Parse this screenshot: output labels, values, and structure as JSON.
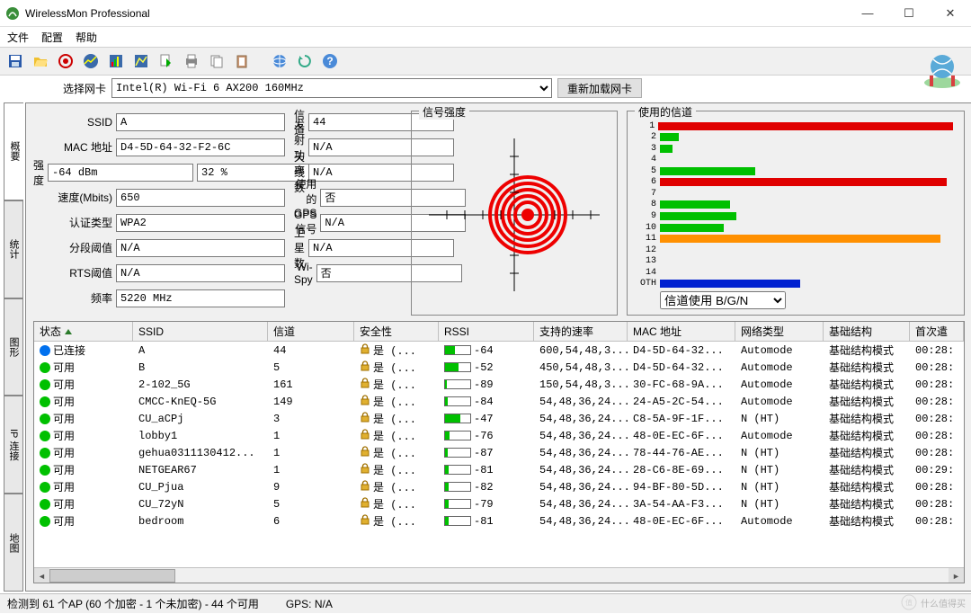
{
  "window": {
    "title": "WirelessMon Professional"
  },
  "menu": {
    "file": "文件",
    "config": "配置",
    "help": "帮助"
  },
  "adapter": {
    "label": "选择网卡",
    "value": "Intel(R) Wi-Fi 6 AX200 160MHz",
    "reload": "重新加载网卡"
  },
  "side_tabs": [
    "概要",
    "统计",
    "图形",
    "IP 连接",
    "地图"
  ],
  "fields": {
    "ssid_label": "SSID",
    "ssid": "A",
    "mac_label": "MAC 地址",
    "mac": "D4-5D-64-32-F2-6C",
    "strength_label": "强度",
    "strength_dbm": "-64 dBm",
    "strength_pct": "32 %",
    "speed_label": "速度(Mbits)",
    "speed": "650",
    "auth_label": "认证类型",
    "auth": "WPA2",
    "frag_label": "分段阈值",
    "frag": "N/A",
    "rts_label": "RTS阈值",
    "rts": "N/A",
    "freq_label": "频率",
    "freq": "5220 MHz",
    "channel_label": "信道",
    "channel": "44",
    "tx_label": "发射功率",
    "tx": "N/A",
    "ant_label": "天线数",
    "ant": "N/A",
    "gps_label": "使用的GPS",
    "gps": "否",
    "gpssig_label": "GPS信号",
    "gpssig": "N/A",
    "sat_label": "卫星数",
    "sat": "N/A",
    "wispy_label": "Wi-Spy",
    "wispy": "否"
  },
  "signal_strength_title": "信号强度",
  "channels_title": "使用的信道",
  "channel_bars": [
    {
      "n": "1",
      "pct": 100,
      "color": "#e00000"
    },
    {
      "n": "2",
      "pct": 6,
      "color": "#00c000"
    },
    {
      "n": "3",
      "pct": 4,
      "color": "#00c000"
    },
    {
      "n": "4",
      "pct": 0,
      "color": "#00c000"
    },
    {
      "n": "5",
      "pct": 30,
      "color": "#00c000"
    },
    {
      "n": "6",
      "pct": 90,
      "color": "#e00000"
    },
    {
      "n": "7",
      "pct": 0,
      "color": "#00c000"
    },
    {
      "n": "8",
      "pct": 22,
      "color": "#00c000"
    },
    {
      "n": "9",
      "pct": 24,
      "color": "#00c000"
    },
    {
      "n": "10",
      "pct": 20,
      "color": "#00c000"
    },
    {
      "n": "11",
      "pct": 88,
      "color": "#ff9000"
    },
    {
      "n": "12",
      "pct": 0,
      "color": "#00c000"
    },
    {
      "n": "13",
      "pct": 0,
      "color": "#00c000"
    },
    {
      "n": "14",
      "pct": 0,
      "color": "#00c000"
    },
    {
      "n": "OTH",
      "pct": 44,
      "color": "#0020d0"
    }
  ],
  "channel_usage_label": "信道使用  B/G/N",
  "grid": {
    "columns": [
      "状态",
      "SSID",
      "信道",
      "安全性",
      "RSSI",
      "支持的速率",
      "MAC 地址",
      "网络类型",
      "基础结构",
      "首次遣"
    ],
    "rows": [
      {
        "status": "已连接",
        "dot": "#0070ee",
        "ssid": "A",
        "ch": "44",
        "sec": "是 (...",
        "rssi": -64,
        "rssi_pct": 40,
        "rates": "600,54,48,3...",
        "mac": "D4-5D-64-32...",
        "net": "Automode",
        "infra": "基础结构模式",
        "first": "00:28:"
      },
      {
        "status": "可用",
        "dot": "#00c000",
        "ssid": "B",
        "ch": "5",
        "sec": "是 (...",
        "rssi": -52,
        "rssi_pct": 55,
        "rates": "450,54,48,3...",
        "mac": "D4-5D-64-32...",
        "net": "Automode",
        "infra": "基础结构模式",
        "first": "00:28:"
      },
      {
        "status": "可用",
        "dot": "#00c000",
        "ssid": "2-102_5G",
        "ch": "161",
        "sec": "是 (...",
        "rssi": -89,
        "rssi_pct": 8,
        "rates": "150,54,48,3...",
        "mac": "30-FC-68-9A...",
        "net": "Automode",
        "infra": "基础结构模式",
        "first": "00:28:"
      },
      {
        "status": "可用",
        "dot": "#00c000",
        "ssid": "CMCC-KnEQ-5G",
        "ch": "149",
        "sec": "是 (...",
        "rssi": -84,
        "rssi_pct": 12,
        "rates": "54,48,36,24...",
        "mac": "24-A5-2C-54...",
        "net": "Automode",
        "infra": "基础结构模式",
        "first": "00:28:"
      },
      {
        "status": "可用",
        "dot": "#00c000",
        "ssid": "CU_aCPj",
        "ch": "3",
        "sec": "是 (...",
        "rssi": -47,
        "rssi_pct": 60,
        "rates": "54,48,36,24...",
        "mac": "C8-5A-9F-1F...",
        "net": "N (HT)",
        "infra": "基础结构模式",
        "first": "00:28:"
      },
      {
        "status": "可用",
        "dot": "#00c000",
        "ssid": "lobby1",
        "ch": "1",
        "sec": "是 (...",
        "rssi": -76,
        "rssi_pct": 18,
        "rates": "54,48,36,24...",
        "mac": "48-0E-EC-6F...",
        "net": "Automode",
        "infra": "基础结构模式",
        "first": "00:28:"
      },
      {
        "status": "可用",
        "dot": "#00c000",
        "ssid": "gehua0311130412...",
        "ch": "1",
        "sec": "是 (...",
        "rssi": -87,
        "rssi_pct": 10,
        "rates": "54,48,36,24...",
        "mac": "78-44-76-AE...",
        "net": "N (HT)",
        "infra": "基础结构模式",
        "first": "00:28:"
      },
      {
        "status": "可用",
        "dot": "#00c000",
        "ssid": "NETGEAR67",
        "ch": "1",
        "sec": "是 (...",
        "rssi": -81,
        "rssi_pct": 14,
        "rates": "54,48,36,24...",
        "mac": "28-C6-8E-69...",
        "net": "N (HT)",
        "infra": "基础结构模式",
        "first": "00:29:"
      },
      {
        "status": "可用",
        "dot": "#00c000",
        "ssid": "CU_Pjua",
        "ch": "9",
        "sec": "是 (...",
        "rssi": -82,
        "rssi_pct": 13,
        "rates": "54,48,36,24...",
        "mac": "94-BF-80-5D...",
        "net": "N (HT)",
        "infra": "基础结构模式",
        "first": "00:28:"
      },
      {
        "status": "可用",
        "dot": "#00c000",
        "ssid": "CU_72yN",
        "ch": "5",
        "sec": "是 (...",
        "rssi": -79,
        "rssi_pct": 16,
        "rates": "54,48,36,24...",
        "mac": "3A-54-AA-F3...",
        "net": "N (HT)",
        "infra": "基础结构模式",
        "first": "00:28:"
      },
      {
        "status": "可用",
        "dot": "#00c000",
        "ssid": "bedroom",
        "ch": "6",
        "sec": "是 (...",
        "rssi": -81,
        "rssi_pct": 14,
        "rates": "54,48,36,24...",
        "mac": "48-0E-EC-6F...",
        "net": "Automode",
        "infra": "基础结构模式",
        "first": "00:28:"
      }
    ]
  },
  "status": {
    "ap": "检测到 61 个AP (60 个加密 - 1 个未加密) - 44 个可用",
    "gps": "GPS: N/A"
  },
  "watermark": "什么值得买"
}
